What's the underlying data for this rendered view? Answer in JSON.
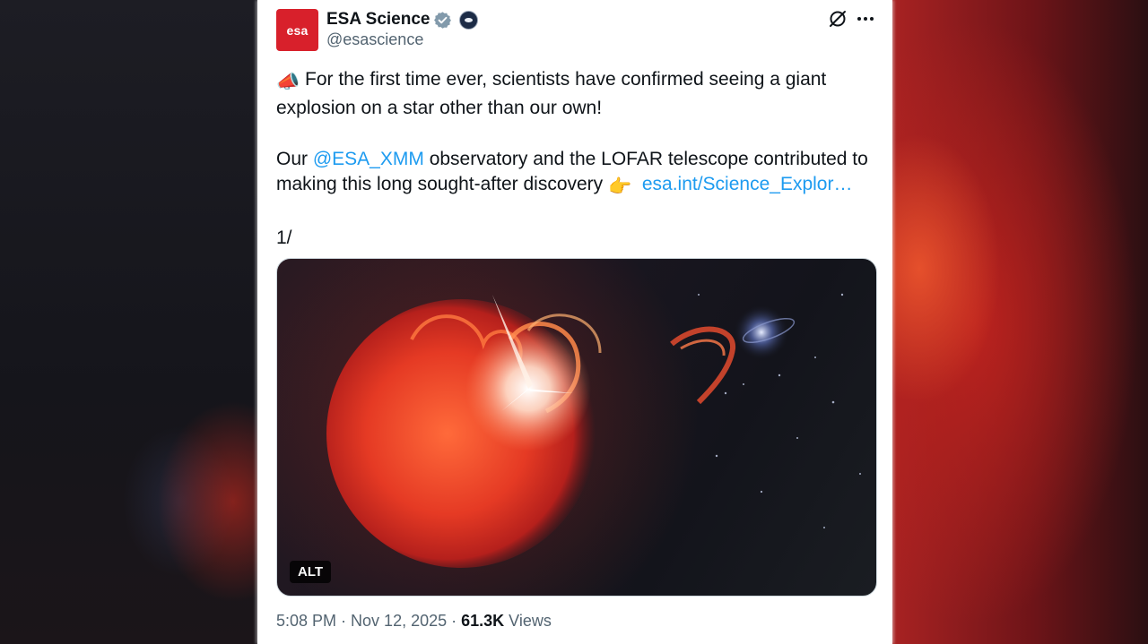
{
  "account": {
    "name": "ESA Science",
    "handle": "@esascience",
    "avatar_text": "esa",
    "avatar_color": "#d8202b",
    "verified_icon": "verified-badge-icon",
    "affiliate_icon": "esa-affiliate-badge-icon"
  },
  "post": {
    "line1_emoji": "📣",
    "line1_text": "For the first time ever, scientists have confirmed seeing a giant explosion on a star other than our own!",
    "line2_prefix": "Our ",
    "line2_mention": "@ESA_XMM",
    "line2_text": " observatory and the LOFAR telescope contributed to making this long sought-after discovery ",
    "line2_emoji": "👉",
    "line2_link": "esa.int/Science_Explor…",
    "line3": "1/"
  },
  "media": {
    "alt_label": "ALT",
    "description_icon": "star-flare-illustration"
  },
  "meta": {
    "time": "5:08 PM",
    "separator": "·",
    "date": "Nov 12, 2025",
    "views_count": "61.3K",
    "views_label": "Views"
  },
  "colors": {
    "link": "#1d9bf0",
    "text": "#0f1419",
    "secondary": "#536471"
  }
}
